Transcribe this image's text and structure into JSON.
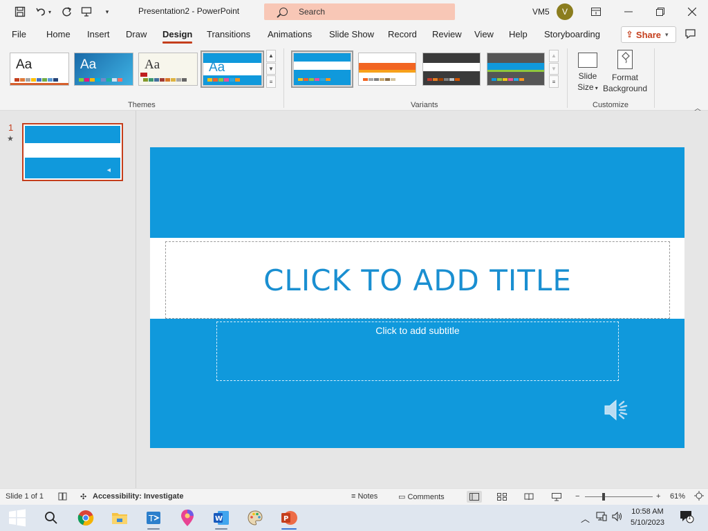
{
  "window": {
    "doc_title": "Presentation2  -  PowerPoint",
    "search_label": "Search",
    "user_name": "VM5",
    "avatar_initial": "V"
  },
  "tabs": [
    {
      "label": "File"
    },
    {
      "label": "Home"
    },
    {
      "label": "Insert"
    },
    {
      "label": "Draw"
    },
    {
      "label": "Design",
      "active": true
    },
    {
      "label": "Transitions"
    },
    {
      "label": "Animations"
    },
    {
      "label": "Slide Show"
    },
    {
      "label": "Record"
    },
    {
      "label": "Review"
    },
    {
      "label": "View"
    },
    {
      "label": "Help"
    },
    {
      "label": "Storyboarding"
    }
  ],
  "share_label": "Share",
  "ribbon": {
    "themes_label": "Themes",
    "variants_label": "Variants",
    "customize_label": "Customize",
    "theme_aa": "Aa",
    "slide_size_label": "Slide Size",
    "slide_size_line1": "Slide",
    "slide_size_line2": "Size",
    "format_bg_line1": "Format",
    "format_bg_line2": "Background"
  },
  "slide": {
    "number": "1",
    "title_placeholder": "CLICK TO ADD TITLE",
    "subtitle_placeholder": "Click to add subtitle"
  },
  "status": {
    "slide_info": "Slide 1 of 1",
    "accessibility": "Accessibility: Investigate",
    "notes_label": "Notes",
    "comments_label": "Comments",
    "zoom_minus": "−",
    "zoom_plus": "+",
    "zoom_level": "61%"
  },
  "clock": {
    "time": "10:58 AM",
    "date": "5/10/2023"
  },
  "notification_count": "1",
  "colors": {
    "accent": "#c43e1c",
    "slide_blue": "#1099dc",
    "title_blue": "#1a8fd1",
    "search_bg": "#f8c7b6"
  }
}
